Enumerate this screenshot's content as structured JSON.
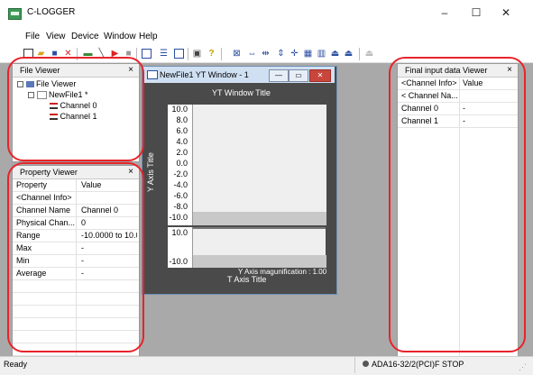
{
  "app": {
    "title": "C-LOGGER"
  },
  "window_controls": {
    "minimize": "–",
    "maximize": "☐",
    "close": "✕"
  },
  "menu": [
    "File",
    "View",
    "Device",
    "Window",
    "Help"
  ],
  "file_viewer": {
    "header": "File Viewer",
    "close": "×",
    "tree": {
      "root": "File Viewer",
      "file": "NewFile1 *",
      "channels": [
        "Channel 0",
        "Channel 1"
      ]
    }
  },
  "property_viewer": {
    "header": "Property Viewer",
    "close": "×",
    "columns": [
      "Property",
      "Value"
    ],
    "rows": [
      {
        "property": "<Channel Info>",
        "value": ""
      },
      {
        "property": "Channel Name",
        "value": "Channel 0"
      },
      {
        "property": "Physical Chan...",
        "value": "0"
      },
      {
        "property": "Range",
        "value": "-10.0000 to 10.0..."
      },
      {
        "property": "Max",
        "value": "-"
      },
      {
        "property": "Min",
        "value": "-"
      },
      {
        "property": "Average",
        "value": "-"
      }
    ]
  },
  "yt_window": {
    "caption": "NewFile1 YT Window - 1",
    "plot_title": "YT Window Title",
    "y_axis_title": "Y Axis Title",
    "x_axis_title": "T Axis Title",
    "magnification": "Y Axis magunification : 1.00",
    "ticks_top": [
      "10.0",
      "8.0",
      "6.0",
      "4.0",
      "2.0",
      "0.0",
      "-2.0",
      "-4.0",
      "-6.0",
      "-8.0",
      "-10.0"
    ],
    "ticks_bottom": [
      "10.0",
      "-10.0"
    ]
  },
  "final_input": {
    "header": "Final input data Viewer",
    "close": "×",
    "columns": [
      "<Channel Info>",
      "Value"
    ],
    "rows": [
      {
        "info": "< Channel Na...",
        "value": ""
      },
      {
        "info": "Channel 0",
        "value": "-"
      },
      {
        "info": "Channel 1",
        "value": "-"
      }
    ]
  },
  "status": {
    "left": "Ready",
    "device": "ADA16-32/2(PCI)F STOP"
  },
  "colors": {
    "annotation": "#e8232a",
    "workspace": "#a9a9a9",
    "plot_bg": "#4a4a4a"
  }
}
